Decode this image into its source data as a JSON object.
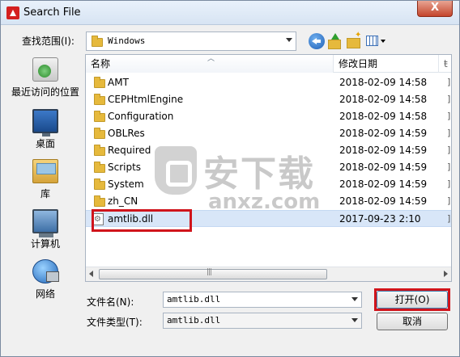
{
  "window": {
    "title": "Search File",
    "close_label": "X"
  },
  "lookin": {
    "label": "查找范围(I):",
    "value": "Windows"
  },
  "places": [
    {
      "label": "最近访问的位置"
    },
    {
      "label": "桌面"
    },
    {
      "label": "库"
    },
    {
      "label": "计算机"
    },
    {
      "label": "网络"
    }
  ],
  "filelist": {
    "columns": {
      "name": "名称",
      "date": "修改日期"
    },
    "rows": [
      {
        "name": "AMT",
        "date": "2018-02-09 14:58",
        "type": "folder"
      },
      {
        "name": "CEPHtmlEngine",
        "date": "2018-02-09 14:58",
        "type": "folder"
      },
      {
        "name": "Configuration",
        "date": "2018-02-09 14:58",
        "type": "folder"
      },
      {
        "name": "OBLRes",
        "date": "2018-02-09 14:59",
        "type": "folder"
      },
      {
        "name": "Required",
        "date": "2018-02-09 14:59",
        "type": "folder"
      },
      {
        "name": "Scripts",
        "date": "2018-02-09 14:59",
        "type": "folder"
      },
      {
        "name": "System",
        "date": "2018-02-09 14:59",
        "type": "folder"
      },
      {
        "name": "zh_CN",
        "date": "2018-02-09 14:59",
        "type": "folder"
      },
      {
        "name": "amtlib.dll",
        "date": "2017-09-23 2:10",
        "type": "dll",
        "selected": true
      }
    ]
  },
  "filename": {
    "label": "文件名(N):",
    "value": "amtlib.dll"
  },
  "filetype": {
    "label": "文件类型(T):",
    "value": "amtlib.dll"
  },
  "buttons": {
    "open": "打开(O)",
    "cancel": "取消"
  },
  "watermark": {
    "cn": "安下载",
    "en": "anxz.com"
  },
  "icons": {
    "app": "app-icon",
    "back": "back-icon",
    "up": "up-folder-icon",
    "newfolder": "new-folder-icon",
    "view": "view-menu-icon"
  },
  "colors": {
    "highlight": "#d0141b",
    "selection": "#d8e6f8"
  }
}
